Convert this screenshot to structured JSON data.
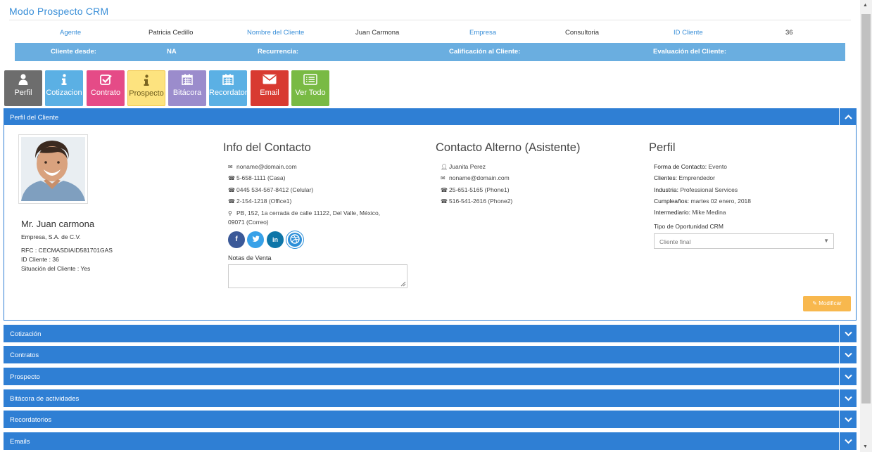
{
  "app_title": "Modo Prospecto CRM",
  "info": {
    "agente_label": "Agente",
    "agente_value": "Patricia Cedillo",
    "cliente_label": "Nombre del Cliente",
    "cliente_value": "Juan Carmona",
    "empresa_label": "Empresa",
    "empresa_value": "Consultoria",
    "id_label": "ID Cliente",
    "id_value": "36"
  },
  "bar": {
    "cliente_desde_label": "Cliente desde:",
    "cliente_desde_value": "NA",
    "recurrencia_label": "Recurrencia:",
    "calificacion_label": "Calificación al Cliente:",
    "evaluacion_label": "Evaluación del Cliente:"
  },
  "buttons": [
    {
      "label": "Perfil",
      "icon": "user-icon",
      "color": "#6d6d6d"
    },
    {
      "label": "Cotizacion",
      "icon": "info-icon",
      "color": "#5bb0e4"
    },
    {
      "label": "Contrato",
      "icon": "checkbox-icon",
      "color": "#e54b87"
    },
    {
      "label": "Prospecto",
      "icon": "info-icon",
      "color": "#fde37f"
    },
    {
      "label": "Bitácora",
      "icon": "calendar-icon",
      "color": "#9b8ccc"
    },
    {
      "label": "Recordatorios",
      "icon": "calendar-icon",
      "color": "#5bb0e4"
    },
    {
      "label": "Email",
      "icon": "envelope-icon",
      "color": "#d83a31"
    },
    {
      "label": "Ver Todo",
      "icon": "list-icon",
      "color": "#79ba44"
    }
  ],
  "panel": {
    "title": "Perfil del Cliente"
  },
  "client": {
    "name": "Mr. Juan carmona",
    "company": "Empresa, S.A. de C.V.",
    "rfc": "RFC : CECMASDIAID581701GAS",
    "id": "ID Cliente : 36",
    "situacion": "Situación del Cliente : Yes"
  },
  "contact": {
    "heading": "Info del Contacto",
    "email": "noname@domain.com",
    "phone_casa": "5-658-1111 (Casa)",
    "phone_celular": "0445 534-567-8412 (Celular)",
    "phone_office": "2-154-1218 (Office1)",
    "address_line1": "PB, 152, 1a cerrada de calle 11122, Del Valle, México,",
    "address_line2": "09071 (Correo)",
    "notes_label": "Notas de Venta"
  },
  "alt_contact": {
    "heading": "Contacto Alterno (Asistente)",
    "name": "Juanita Perez",
    "email": "noname@domain.com",
    "phone1": "25-651-5165 (Phone1)",
    "phone2": "516-541-2616 (Phone2)"
  },
  "profile": {
    "heading": "Perfil",
    "forma_label": "Forma de Contacto:",
    "forma_value": "Evento",
    "clientes_label": "Clientes:",
    "clientes_value": "Emprendedor",
    "industria_label": "Industria:",
    "industria_value": "Professional Services",
    "cumple_label": "Cumpleaños:",
    "cumple_value": "martes 02 enero, 2018",
    "intermediario_label": "Intermediario:",
    "intermediario_value": "Mike Medina",
    "tipo_label": "Tipo de Oportunidad CRM",
    "tipo_value": "Cliente final",
    "modificar_label": "Modificar"
  },
  "sections": [
    "Cotización",
    "Contratos",
    "Prospecto",
    "Bitácora de actividades",
    "Recordatorios",
    "Emails"
  ]
}
